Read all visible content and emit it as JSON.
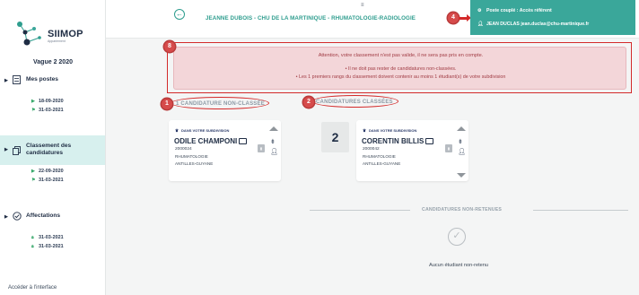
{
  "sidebar": {
    "logo_text": "SIIMOP",
    "logo_sub": "Appariement",
    "vague": "Vague 2 2020",
    "sections": [
      {
        "label": "Mes postes",
        "dates": [
          "18-09-2020",
          "31-03-2021"
        ]
      },
      {
        "label": "Classement des candidatures",
        "dates": [
          "22-09-2020",
          "31-03-2021"
        ]
      },
      {
        "label": "Affectations",
        "dates": [
          "31-03-2021",
          "31-03-2021"
        ]
      }
    ],
    "access_link": "Accéder à l'interface"
  },
  "topbar": {
    "title": "JEANNE DUBOIS - CHU DE LA MARTINIQUE - RHUMATOLOGIE-RADIOLOGIE",
    "user_line1": "Poste couplé : Accès référent",
    "user_line2": "JEAN DUCLAS jean.duclas@chu-martinique.fr",
    "badge": "4",
    "menu_glyph": "≡"
  },
  "alert": {
    "badge": "8",
    "line1": "Attention, votre classement n'est pas valide, il ne sera pas pris en compte.",
    "line2": "• Il ne doit pas rester de candidatures non-classées.",
    "line3": "• Les 1 premiers rangs du classement doivent contenir au moins 1 étudiant(s) de votre subdivision"
  },
  "sections": {
    "non_classee": {
      "badge": "1",
      "title": "1 CANDIDATURE NON-CLASSÉE"
    },
    "classees": {
      "badge": "2",
      "title": "CANDIDATURES CLASSÉES"
    }
  },
  "cards": [
    {
      "subdivision": "DANS VOTRE SUBDIVISION",
      "name": "ODILE CHAMPONI",
      "id": "2000024",
      "specialty": "RHUMATOLOGIE",
      "location": "ANTILLES-GUYANE"
    },
    {
      "subdivision": "DANS VOTRE SUBDIVISION",
      "name": "CORENTIN BILLIS",
      "id": "2000042",
      "specialty": "RHUMATOLOGIE",
      "location": "ANTILLES-GUYANE"
    }
  ],
  "rank": "2",
  "non_retenues": {
    "title": "CANDIDATURES NON-RETENUES",
    "empty": "Aucun étudiant non-retenu"
  },
  "colors": {
    "accent": "#2e9d8e",
    "alert_bg": "#f3d6d9",
    "alert_text": "#a13c44",
    "annotation": "#d32a2a"
  }
}
